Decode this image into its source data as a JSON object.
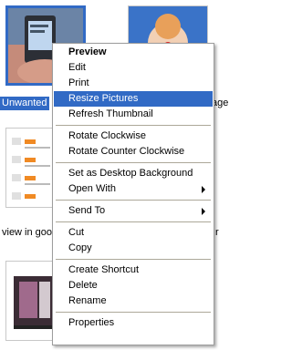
{
  "captions": {
    "top_left": "Unwanted",
    "top_right": "age",
    "mid_left": "view in goo",
    "mid_right": "r"
  },
  "thumbnails": {
    "top_left": "photo of hand holding phone",
    "top_right": "photo of clown",
    "mid_left": "screenshot of list",
    "bottom_left": "photo of screen"
  },
  "menu": {
    "preview": "Preview",
    "edit": "Edit",
    "print": "Print",
    "resize_pictures": "Resize Pictures",
    "refresh_thumbnail": "Refresh Thumbnail",
    "rotate_clockwise": "Rotate Clockwise",
    "rotate_counter_clockwise": "Rotate Counter Clockwise",
    "set_as_desktop_background": "Set as Desktop Background",
    "open_with": "Open With",
    "send_to": "Send To",
    "cut": "Cut",
    "copy": "Copy",
    "create_shortcut": "Create Shortcut",
    "delete": "Delete",
    "rename": "Rename",
    "properties": "Properties"
  },
  "colors": {
    "selection": "#316ac5",
    "menu_border": "#9d9d9d",
    "separator": "#aca899"
  }
}
